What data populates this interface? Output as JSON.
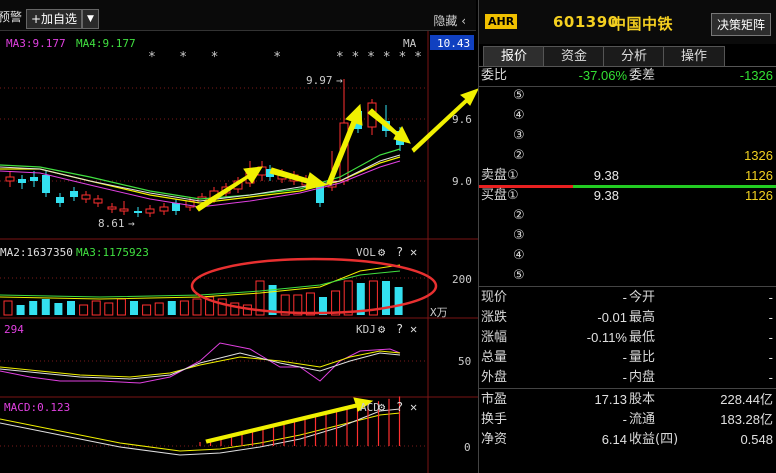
{
  "toolbar": {
    "alert_label": "预警",
    "add_watch_label": "+加自选",
    "dropdown_glyph": "▼",
    "hide_label": "隐藏 ‹"
  },
  "main_chart": {
    "ma_legend": {
      "ma3": "MA3:9.177",
      "ma4": "MA4:9.177",
      "ma": "MA"
    },
    "current_price_tag": "10.43",
    "price_labels": [
      "9.6",
      "9.0"
    ],
    "high_marker": "9.97",
    "low_marker": "8.61",
    "stars": "*   *   *       *       * * * * * *"
  },
  "vol_pane": {
    "legend_ma2": "MA2:1637350",
    "legend_ma3": "MA3:1175923",
    "name": "VOL",
    "axis_value": "200",
    "unit": "X万"
  },
  "kdj_pane": {
    "legend": "294",
    "name": "KDJ",
    "axis_value": "50"
  },
  "macd_pane": {
    "legend": "MACD:0.123",
    "name": "ACD",
    "axis_value": "0"
  },
  "quote": {
    "badge": "AHR",
    "code": "601390",
    "name": "中国中铁",
    "decision_button": "决策矩阵",
    "tabs": [
      "报价",
      "资金",
      "分析",
      "操作"
    ],
    "weibi_label": "委比",
    "weibi_value": "-37.06%",
    "weicha_label": "委差",
    "weicha_value": "-1326",
    "sell_levels": [
      {
        "label": "⑤",
        "price": "",
        "vol": ""
      },
      {
        "label": "④",
        "price": "",
        "vol": ""
      },
      {
        "label": "③",
        "price": "",
        "vol": ""
      },
      {
        "label": "②",
        "price": "",
        "vol": "1326"
      },
      {
        "label": "卖盘①",
        "price": "9.38",
        "vol": "1126"
      }
    ],
    "buy_levels": [
      {
        "label": "买盘①",
        "price": "9.38",
        "vol": "1126"
      },
      {
        "label": "②",
        "price": "",
        "vol": ""
      },
      {
        "label": "③",
        "price": "",
        "vol": ""
      },
      {
        "label": "④",
        "price": "",
        "vol": ""
      },
      {
        "label": "⑤",
        "price": "",
        "vol": ""
      }
    ],
    "stats": [
      {
        "l1": "现价",
        "v1": "-",
        "l2": "今开",
        "v2": "-"
      },
      {
        "l1": "涨跌",
        "v1": "-0.01",
        "l2": "最高",
        "v2": "-"
      },
      {
        "l1": "涨幅",
        "v1": "-0.11%",
        "l2": "最低",
        "v2": "-"
      },
      {
        "l1": "总量",
        "v1": "-",
        "l2": "量比",
        "v2": "-"
      },
      {
        "l1": "外盘",
        "v1": "-",
        "l2": "内盘",
        "v2": "-"
      }
    ],
    "fundamentals": [
      {
        "l1": "市盈",
        "v1": "17.13",
        "l2": "股本",
        "v2": "228.44亿"
      },
      {
        "l1": "换手",
        "v1": "-",
        "l2": "流通",
        "v2": "183.28亿"
      },
      {
        "l1": "净资",
        "v1": "6.14",
        "l2": "收益(四)",
        "v2": "0.548"
      }
    ]
  }
}
